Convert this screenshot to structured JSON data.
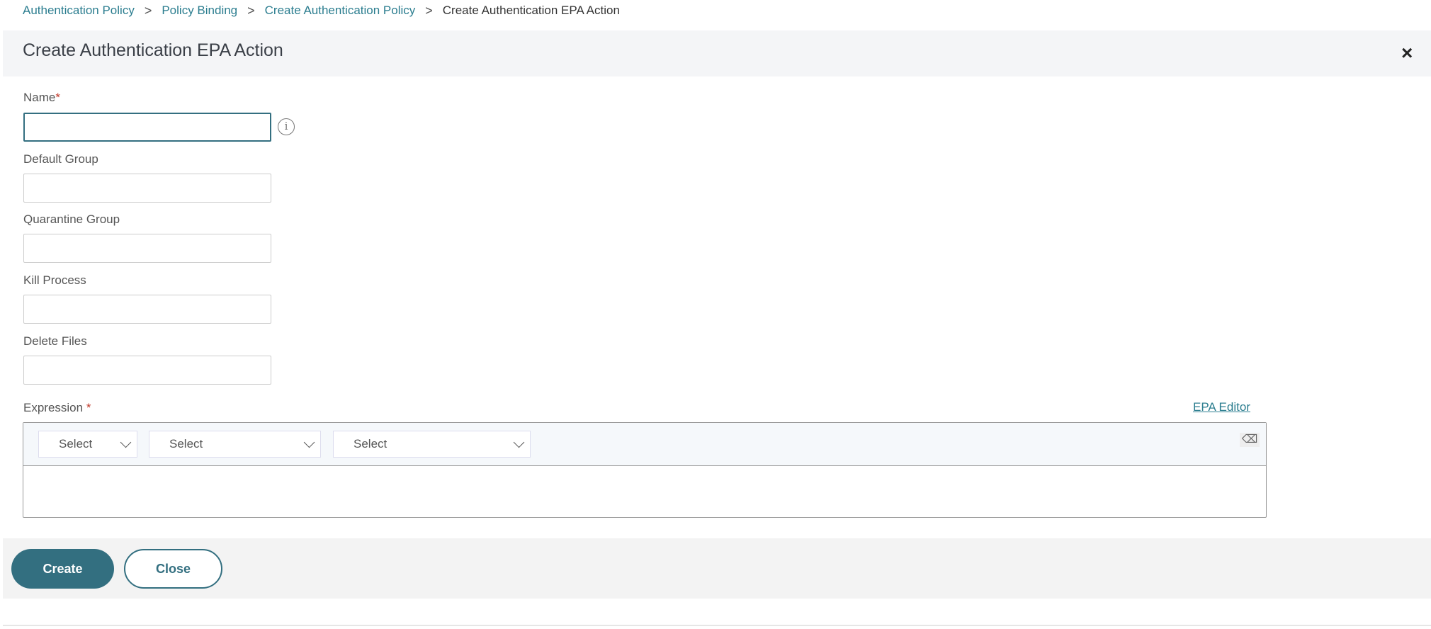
{
  "breadcrumb": [
    {
      "label": "Authentication Policy"
    },
    {
      "label": "Policy Binding"
    },
    {
      "label": "Create Authentication Policy"
    },
    {
      "label": "Create Authentication EPA Action"
    }
  ],
  "dialog": {
    "title": "Create Authentication EPA Action",
    "close_icon": "×"
  },
  "form": {
    "name": {
      "label": "Name",
      "required": "*",
      "value": "",
      "info_icon": "i"
    },
    "default_group": {
      "label": "Default Group",
      "value": ""
    },
    "quarantine_group": {
      "label": "Quarantine Group",
      "value": ""
    },
    "kill_process": {
      "label": "Kill Process",
      "value": ""
    },
    "delete_files": {
      "label": "Delete Files",
      "value": ""
    },
    "expression": {
      "label": "Expression",
      "required": "*",
      "epa_editor": "EPA Editor",
      "selects": [
        "Select",
        "Select",
        "Select"
      ],
      "clear_icon": "⌫",
      "value": ""
    }
  },
  "footer": {
    "create": "Create",
    "close": "Close"
  },
  "colors": {
    "accent": "#336f80",
    "link": "#2b7d8f"
  }
}
